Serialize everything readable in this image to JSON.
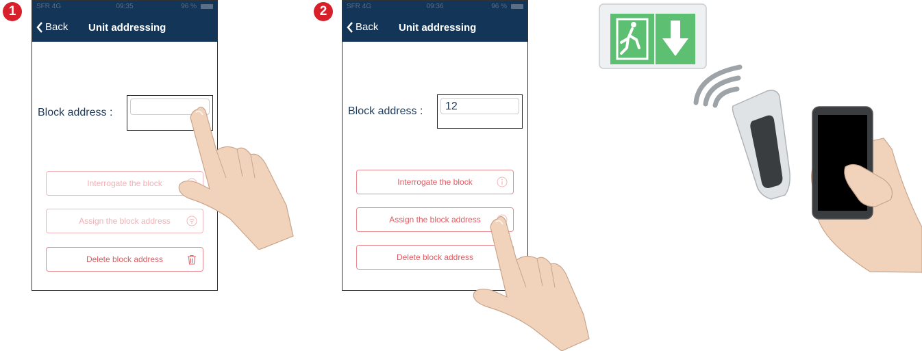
{
  "steps": [
    {
      "badge": "1",
      "status": {
        "carrier": "SFR 4G",
        "time": "09:35",
        "battery": "96 %"
      },
      "nav": {
        "back_label": "Back",
        "title": "Unit addressing"
      },
      "field": {
        "label": "Block address :",
        "value": ""
      },
      "buttons": [
        {
          "label": "Interrogate the block",
          "icon": "info-icon"
        },
        {
          "label": "Assign the block address",
          "icon": "wifi-icon"
        },
        {
          "label": "Delete block address",
          "icon": "trash-icon"
        }
      ]
    },
    {
      "badge": "2",
      "status": {
        "carrier": "SFR 4G",
        "time": "09:36",
        "battery": "96 %"
      },
      "nav": {
        "back_label": "Back",
        "title": "Unit addressing"
      },
      "field": {
        "label": "Block address :",
        "value": "12"
      },
      "buttons": [
        {
          "label": "Interrogate the block",
          "icon": "info-icon"
        },
        {
          "label": "Assign the block address",
          "icon": "wifi-icon"
        },
        {
          "label": "Delete block address",
          "icon": "trash-icon"
        }
      ]
    }
  ],
  "colors": {
    "navbar": "#133558",
    "accent": "#d7202a",
    "button_text": "#e05a61",
    "exit_sign_green": "#3aa655"
  }
}
